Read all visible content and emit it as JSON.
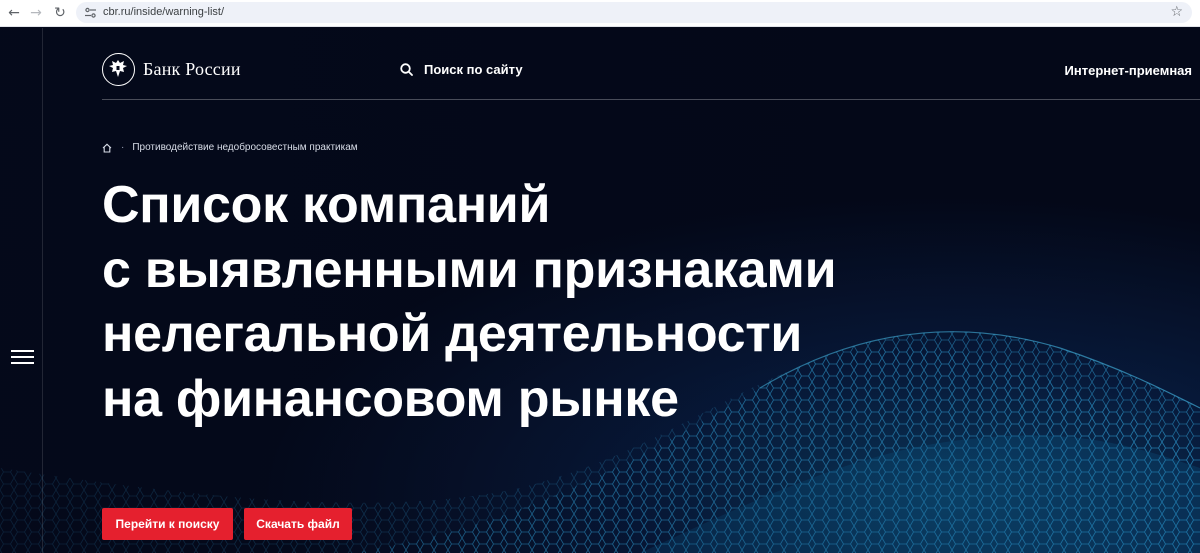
{
  "browser": {
    "url": "cbr.ru/inside/warning-list/"
  },
  "header": {
    "logo_text": "Банк России",
    "search_label": "Поиск по сайту",
    "reception_label": "Интернет-приемная"
  },
  "breadcrumb": {
    "separator": "·",
    "item": "Противодействие недобросовестным практикам"
  },
  "hero": {
    "title_lines": [
      "Список компаний",
      "с выявленными признаками",
      "нелегальной деятельности",
      "на финансовом рынке"
    ],
    "primary_button": "Перейти к поиску",
    "secondary_button": "Скачать файл"
  },
  "colors": {
    "accent": "#e5202e",
    "background": "#050a1c"
  }
}
